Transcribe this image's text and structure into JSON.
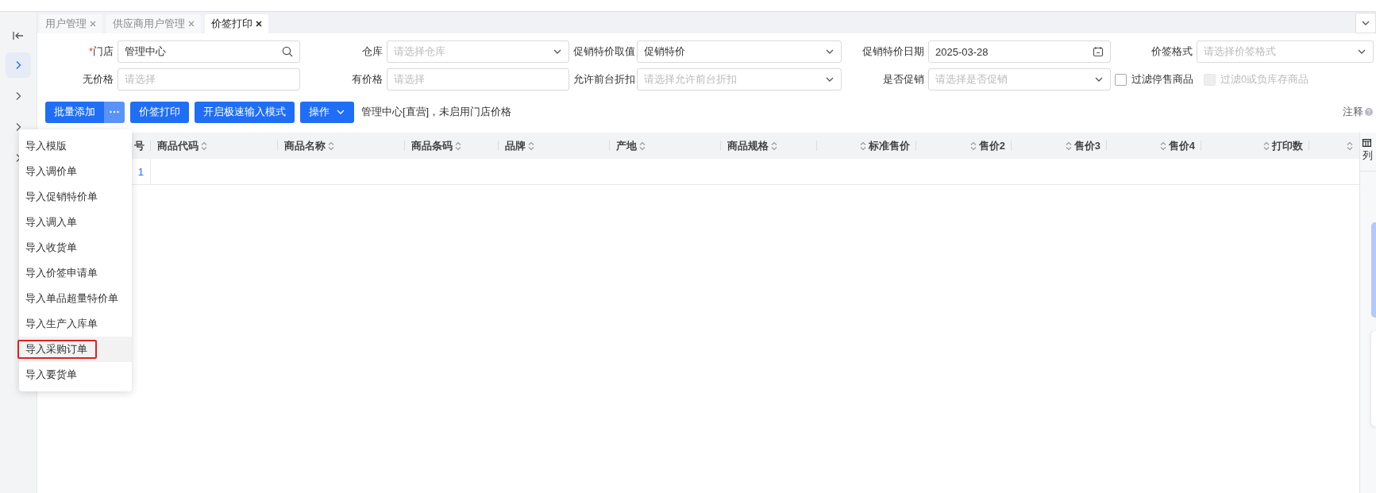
{
  "sidebar": {
    "items": [
      {
        "selected": true
      },
      {
        "selected": false
      },
      {
        "selected": false
      },
      {
        "selected": false
      }
    ]
  },
  "tabs": [
    {
      "label": "用户管理",
      "selected": false
    },
    {
      "label": "供应商用户管理",
      "selected": false
    },
    {
      "label": "价签打印",
      "selected": true
    }
  ],
  "filters": [
    {
      "kind": "search",
      "label": "门店",
      "required_mark": "*",
      "value": "管理中心"
    },
    {
      "kind": "select",
      "label": "仓库",
      "placeholder": "请选择仓库"
    },
    {
      "kind": "select",
      "label": "促销特价取值",
      "value": "促销特价"
    },
    {
      "kind": "date",
      "label": "促销特价日期",
      "value": "2025-03-28"
    },
    {
      "kind": "select",
      "label": "价签格式",
      "placeholder": "请选择价签格式"
    },
    {
      "kind": "text",
      "label": "无价格",
      "placeholder": "请选择"
    },
    {
      "kind": "text",
      "label": "有价格",
      "placeholder": "请选择"
    },
    {
      "kind": "select",
      "label": "允许前台折扣",
      "placeholder": "请选择允许前台折扣"
    },
    {
      "kind": "select",
      "label": "是否促销",
      "placeholder": "请选择是否促销"
    }
  ],
  "checkboxes": [
    {
      "label": "过滤停售商品",
      "checked": false,
      "disabled": false
    },
    {
      "label": "过滤0或负库存商品",
      "checked": false,
      "disabled": true
    }
  ],
  "toolbar": {
    "split_button": {
      "label": "批量添加"
    },
    "buttons": [
      {
        "kind": "plain",
        "label": "价签打印"
      },
      {
        "kind": "plain",
        "label": "开启极速输入模式"
      },
      {
        "kind": "dropdown",
        "label": "操作"
      }
    ],
    "info": "管理中心[直营]，未启用门店价格",
    "note": "注释"
  },
  "menu": {
    "items": [
      {
        "label": "导入模版",
        "highlighted": false,
        "annotated": false
      },
      {
        "label": "导入调价单",
        "highlighted": false,
        "annotated": false
      },
      {
        "label": "导入促销特价单",
        "highlighted": false,
        "annotated": false
      },
      {
        "label": "导入调入单",
        "highlighted": false,
        "annotated": false
      },
      {
        "label": "导入收货单",
        "highlighted": false,
        "annotated": false
      },
      {
        "label": "导入价签申请单",
        "highlighted": false,
        "annotated": false
      },
      {
        "label": "导入单品超量特价单",
        "highlighted": false,
        "annotated": false
      },
      {
        "label": "导入生产入库单",
        "highlighted": false,
        "annotated": false
      },
      {
        "label": "导入采购订单",
        "highlighted": true,
        "annotated": true
      },
      {
        "label": "导入要货单",
        "highlighted": false,
        "annotated": false
      }
    ]
  },
  "table": {
    "columns": [
      {
        "label": "号",
        "kind": "index"
      },
      {
        "label": "商品代码",
        "kind": "text"
      },
      {
        "label": "商品名称",
        "kind": "text"
      },
      {
        "label": "商品条码",
        "kind": "text"
      },
      {
        "label": "品牌",
        "kind": "text"
      },
      {
        "label": "产地",
        "kind": "text"
      },
      {
        "label": "商品规格",
        "kind": "text"
      },
      {
        "label": "标准售价",
        "kind": "number"
      },
      {
        "label": "售价2",
        "kind": "number"
      },
      {
        "label": "售价3",
        "kind": "number"
      },
      {
        "label": "售价4",
        "kind": "number"
      },
      {
        "label": "打印数",
        "kind": "number"
      },
      {
        "kind": "number"
      }
    ],
    "rows": [
      {
        "index": "1"
      }
    ]
  },
  "side_panel": {
    "label": "列"
  }
}
